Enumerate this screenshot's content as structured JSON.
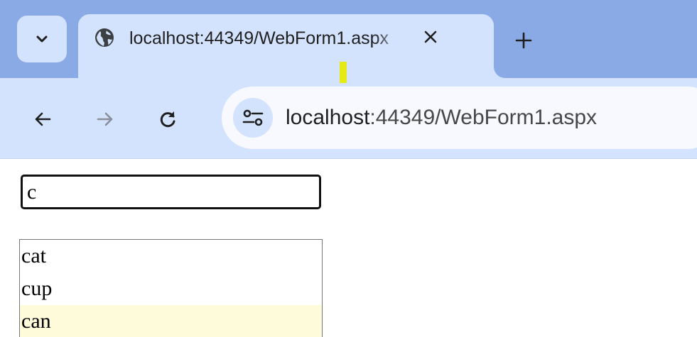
{
  "tab": {
    "title": "localhost:44349/WebForm1.aspx",
    "favicon": "globe-icon"
  },
  "icons": {
    "tab_search": "chevron-down-icon",
    "close": "close-icon",
    "new_tab": "plus-icon",
    "back": "arrow-left-icon",
    "forward": "arrow-right-icon",
    "reload": "reload-icon",
    "site_info": "tune-icon"
  },
  "address_bar": {
    "host": "localhost",
    "rest": ":44349/WebForm1.aspx"
  },
  "search": {
    "value": "c"
  },
  "suggestions": [
    {
      "label": "cat"
    },
    {
      "label": "cup"
    },
    {
      "label": "can"
    }
  ],
  "colors": {
    "tabstrip": "#8aaae5",
    "toolbar": "#d3e3fd",
    "highlight": "#fdfbd9"
  }
}
